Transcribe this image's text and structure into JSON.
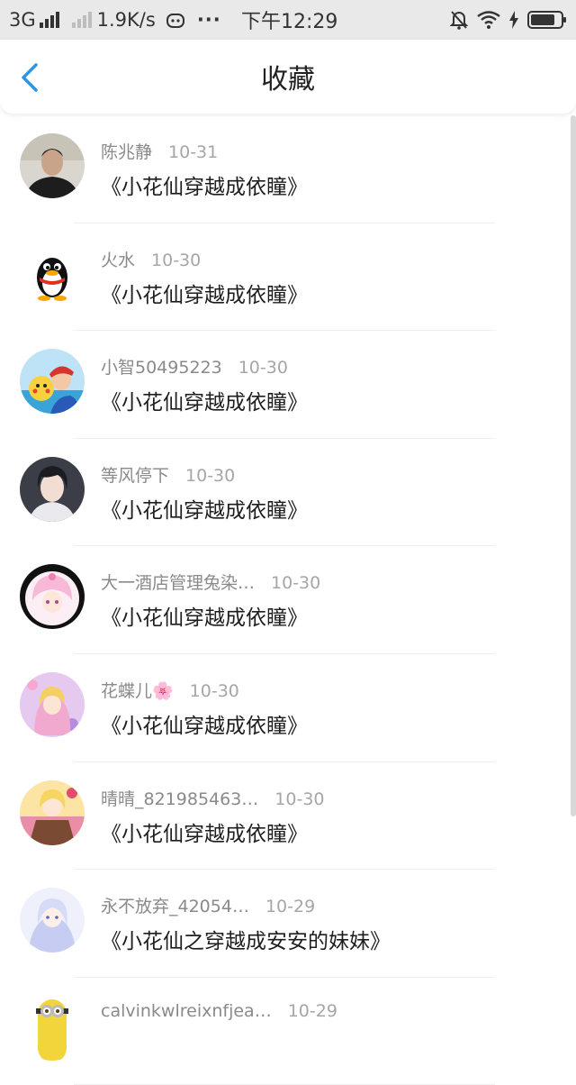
{
  "status": {
    "network": "3G",
    "speed": "1.9K/s",
    "dots": "···",
    "time": "下午12:29"
  },
  "nav": {
    "title": "收藏"
  },
  "items": [
    {
      "name": "陈兆静",
      "date": "10-31",
      "title": "《小花仙穿越成依瞳》",
      "avatar": "person-photo"
    },
    {
      "name": "火水",
      "date": "10-30",
      "title": "《小花仙穿越成依瞳》",
      "avatar": "qq-penguin"
    },
    {
      "name": "小智50495223",
      "date": "10-30",
      "title": "《小花仙穿越成依瞳》",
      "avatar": "pokemon-trainer"
    },
    {
      "name": "等风停下",
      "date": "10-30",
      "title": "《小花仙穿越成依瞳》",
      "avatar": "anime-boy"
    },
    {
      "name": "大一酒店管理兔染…",
      "date": "10-30",
      "title": "《小花仙穿越成依瞳》",
      "avatar": "anime-girl-pink"
    },
    {
      "name": "花蝶儿🌸",
      "date": "10-30",
      "title": "《小花仙穿越成依瞳》",
      "avatar": "anime-girl-purple"
    },
    {
      "name": "晴晴_821985463…",
      "date": "10-30",
      "title": "《小花仙穿越成依瞳》",
      "avatar": "anime-girl-cake"
    },
    {
      "name": "永不放弃_42054…",
      "date": "10-29",
      "title": "《小花仙之穿越成安安的妹妹》",
      "avatar": "anime-girl-blue"
    },
    {
      "name": "calvinkwlreixnfjea…",
      "date": "10-29",
      "title": "",
      "avatar": "minion"
    }
  ]
}
